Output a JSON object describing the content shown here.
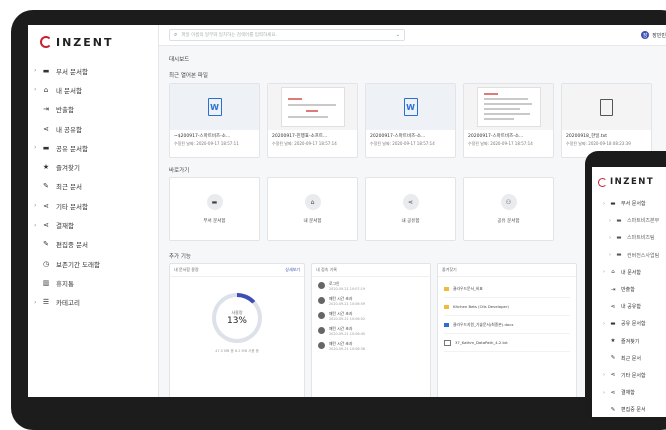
{
  "app": {
    "logo_text": "INZENT"
  },
  "sidebar": {
    "items": [
      {
        "label": "부서 문서함",
        "icon": "folder-icon",
        "chev": true
      },
      {
        "label": "내 문서함",
        "icon": "home-icon",
        "chev": true
      },
      {
        "label": "반출함",
        "icon": "export-icon",
        "chev": false
      },
      {
        "label": "내 공유함",
        "icon": "share-icon",
        "chev": false
      },
      {
        "label": "공유 문서함",
        "icon": "folder-icon",
        "chev": true
      },
      {
        "label": "즐겨찾기",
        "icon": "star-icon",
        "chev": false
      },
      {
        "label": "최근 문서",
        "icon": "edit-icon",
        "chev": false
      },
      {
        "label": "기타 문서함",
        "icon": "share-icon",
        "chev": true
      },
      {
        "label": "결재함",
        "icon": "share-icon",
        "chev": true
      },
      {
        "label": "편집중 문서",
        "icon": "edit-icon",
        "chev": false
      },
      {
        "label": "보존기간 도래함",
        "icon": "clock-icon",
        "chev": false
      },
      {
        "label": "휴지통",
        "icon": "trash-icon",
        "chev": false
      },
      {
        "label": "카테고리",
        "icon": "list-icon",
        "chev": true
      }
    ]
  },
  "topbar": {
    "search_placeholder": "파일 이름의 일부와 일치하는 검색어를 입력하세요.",
    "user_name": "장민빈",
    "user_initial": "장"
  },
  "breadcrumb": "대시보드",
  "recent": {
    "title": "최근 열어본 파일",
    "files": [
      {
        "name": "~$200917-스마트비즈-소...",
        "meta": "수정된 날짜: 2020-09-17 18:57:11",
        "thumb": "word"
      },
      {
        "name": "20200917-진행표-소프트...",
        "meta": "수정된 날짜: 2020-09-17 18:57:14",
        "thumb": "diagram"
      },
      {
        "name": "20200917-스마트비즈-소...",
        "meta": "수정된 날짜: 2020-09-17 18:57:14",
        "thumb": "word"
      },
      {
        "name": "20200917-스마트비즈-소...",
        "meta": "수정된 날짜: 2020-09-17 18:57:14",
        "thumb": "page"
      },
      {
        "name": "20200918_한일.txt",
        "meta": "수정된 날짜: 2020-09-18 08:23:39",
        "thumb": "generic"
      }
    ]
  },
  "quick": {
    "title": "바로가기",
    "items": [
      {
        "label": "부서 문서함",
        "icon": "folder-icon"
      },
      {
        "label": "내 문서함",
        "icon": "home-icon"
      },
      {
        "label": "내 공유함",
        "icon": "share-icon"
      },
      {
        "label": "공유 문서함",
        "icon": "group-icon"
      }
    ]
  },
  "extra": {
    "title": "추가 기능",
    "storage": {
      "header": "내 문서함 용량",
      "link": "상세보기",
      "caption": "사용량",
      "percent_label": "13%",
      "percent": 13,
      "footer": "47.5 MB 중 6.2 MB 사용 중"
    },
    "history": {
      "header": "내 접속 기록",
      "items": [
        {
          "title": "로그인",
          "time": "2020-09-21 10:07:19"
        },
        {
          "title": "패턴 시간 초과",
          "time": "2020-09-21 10:06:59"
        },
        {
          "title": "패턴 시간 초과",
          "time": "2020-09-21 10:06:52"
        },
        {
          "title": "패턴 시간 초과",
          "time": "2020-09-21 10:06:45"
        },
        {
          "title": "패턴 시간 초과",
          "time": "2020-09-21 10:06:38"
        }
      ]
    },
    "favorites": {
      "header": "즐겨찾기",
      "items": [
        {
          "name": "클라우드문서_비표",
          "icon": "folder"
        },
        {
          "name": "Kitchen Bets (Olis Developer)",
          "icon": "folder"
        },
        {
          "name": "클라우드지원_기술문서(최종본).docx",
          "icon": "doc"
        },
        {
          "name": "37_Kathm_DataPath_4.2.txt",
          "icon": "file"
        }
      ]
    }
  },
  "phone": {
    "logo_text": "INZENT",
    "items": [
      {
        "label": "부서 문서함",
        "icon": "folder-icon",
        "chev": true,
        "indent": false
      },
      {
        "label": "스마트비즈본부",
        "icon": "folder-icon",
        "chev": true,
        "indent": true
      },
      {
        "label": "스마트비즈팀",
        "icon": "folder-icon",
        "chev": true,
        "indent": true
      },
      {
        "label": "컨버전스사업팀",
        "icon": "folder-icon",
        "chev": true,
        "indent": true
      },
      {
        "label": "내 문서함",
        "icon": "home-icon",
        "chev": true,
        "indent": false
      },
      {
        "label": "반출함",
        "icon": "export-icon",
        "chev": false,
        "indent": false
      },
      {
        "label": "내 공유함",
        "icon": "share-icon",
        "chev": false,
        "indent": false
      },
      {
        "label": "공유 문서함",
        "icon": "folder-icon",
        "chev": true,
        "indent": false
      },
      {
        "label": "즐겨찾기",
        "icon": "star-icon",
        "chev": false,
        "indent": false
      },
      {
        "label": "최근 문서",
        "icon": "edit-icon",
        "chev": false,
        "indent": false
      },
      {
        "label": "기타 문서함",
        "icon": "share-icon",
        "chev": true,
        "indent": false
      },
      {
        "label": "결재함",
        "icon": "share-icon",
        "chev": true,
        "indent": false
      },
      {
        "label": "편집중 문서",
        "icon": "edit-icon",
        "chev": false,
        "indent": false
      }
    ]
  },
  "colors": {
    "accent": "#3e4fb3",
    "brand_red": "#c8202e",
    "word_blue": "#2a6fd6"
  }
}
